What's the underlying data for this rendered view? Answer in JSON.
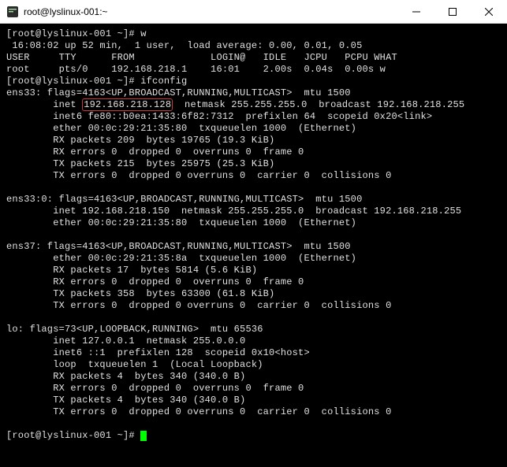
{
  "window": {
    "title": "root@lyslinux-001:~",
    "icon": "terminal-icon"
  },
  "terminal": {
    "prompt1": "[root@lyslinux-001 ~]# ",
    "cmd_w": "w",
    "w_output": {
      "uptime_line": " 16:08:02 up 52 min,  1 user,  load average: 0.00, 0.01, 0.05",
      "header": "USER     TTY      FROM             LOGIN@   IDLE   JCPU   PCPU WHAT",
      "row1": "root     pts/0    192.168.218.1    16:01    2.00s  0.04s  0.00s w"
    },
    "prompt2": "[root@lyslinux-001 ~]# ",
    "cmd_ifconfig": "ifconfig",
    "ens33": {
      "l1": "ens33: flags=4163<UP,BROADCAST,RUNNING,MULTICAST>  mtu 1500",
      "l2a": "        inet ",
      "l2_ip": "192.168.218.128",
      "l2b": "  netmask 255.255.255.0  broadcast 192.168.218.255",
      "l3": "        inet6 fe80::b0ea:1433:6f82:7312  prefixlen 64  scopeid 0x20<link>",
      "l4": "        ether 00:0c:29:21:35:80  txqueuelen 1000  (Ethernet)",
      "l5": "        RX packets 209  bytes 19765 (19.3 KiB)",
      "l6": "        RX errors 0  dropped 0  overruns 0  frame 0",
      "l7": "        TX packets 215  bytes 25975 (25.3 KiB)",
      "l8": "        TX errors 0  dropped 0 overruns 0  carrier 0  collisions 0"
    },
    "ens33_0": {
      "l1": "ens33:0: flags=4163<UP,BROADCAST,RUNNING,MULTICAST>  mtu 1500",
      "l2": "        inet 192.168.218.150  netmask 255.255.255.0  broadcast 192.168.218.255",
      "l3": "        ether 00:0c:29:21:35:80  txqueuelen 1000  (Ethernet)"
    },
    "ens37": {
      "l1": "ens37: flags=4163<UP,BROADCAST,RUNNING,MULTICAST>  mtu 1500",
      "l2": "        ether 00:0c:29:21:35:8a  txqueuelen 1000  (Ethernet)",
      "l3": "        RX packets 17  bytes 5814 (5.6 KiB)",
      "l4": "        RX errors 0  dropped 0  overruns 0  frame 0",
      "l5": "        TX packets 358  bytes 63300 (61.8 KiB)",
      "l6": "        TX errors 0  dropped 0 overruns 0  carrier 0  collisions 0"
    },
    "lo": {
      "l1": "lo: flags=73<UP,LOOPBACK,RUNNING>  mtu 65536",
      "l2": "        inet 127.0.0.1  netmask 255.0.0.0",
      "l3": "        inet6 ::1  prefixlen 128  scopeid 0x10<host>",
      "l4": "        loop  txqueuelen 1  (Local Loopback)",
      "l5": "        RX packets 4  bytes 340 (340.0 B)",
      "l6": "        RX errors 0  dropped 0  overruns 0  frame 0",
      "l7": "        TX packets 4  bytes 340 (340.0 B)",
      "l8": "        TX errors 0  dropped 0 overruns 0  carrier 0  collisions 0"
    },
    "prompt3": "[root@lyslinux-001 ~]# "
  }
}
